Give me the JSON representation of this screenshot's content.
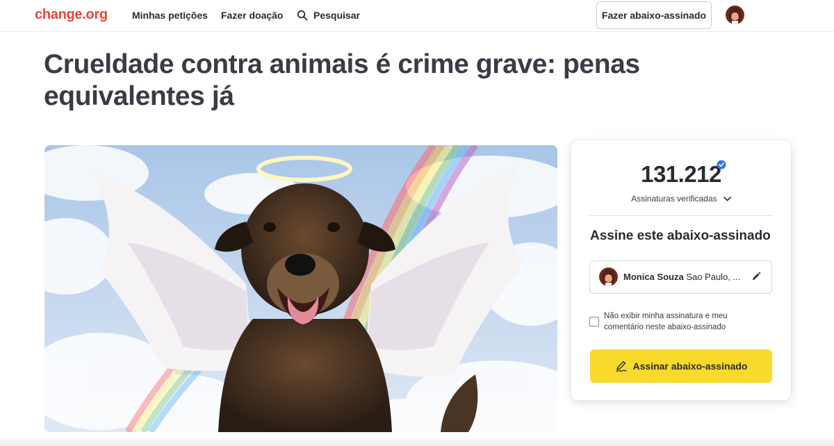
{
  "header": {
    "logo": "change.org",
    "nav": {
      "my_petitions": "Minhas petições",
      "donate": "Fazer doação",
      "search": "Pesquisar"
    },
    "start_button": "Fazer abaixo-assinado"
  },
  "petition": {
    "title": "Crueldade contra animais é crime grave: penas equivalentes já"
  },
  "card": {
    "signature_count": "131.212",
    "verified_label": "Assinaturas verificadas",
    "heading": "Assine este abaixo-assinado",
    "signer": {
      "name": "Monica Souza",
      "location": "Sao Paulo, ..."
    },
    "hide_option": "Não exibir minha assinatura e meu comentário neste abaixo-assinado",
    "hide_checked": false,
    "sign_button": "Assinar abaixo-assinado"
  },
  "colors": {
    "brand": "#e8463b",
    "sign_button": "#f8da2b",
    "verified_badge": "#3f73e0",
    "text": "#2b2a33"
  },
  "icons": [
    "search-icon",
    "verified-icon",
    "chevron-down-icon",
    "pencil-icon",
    "signature-icon"
  ]
}
